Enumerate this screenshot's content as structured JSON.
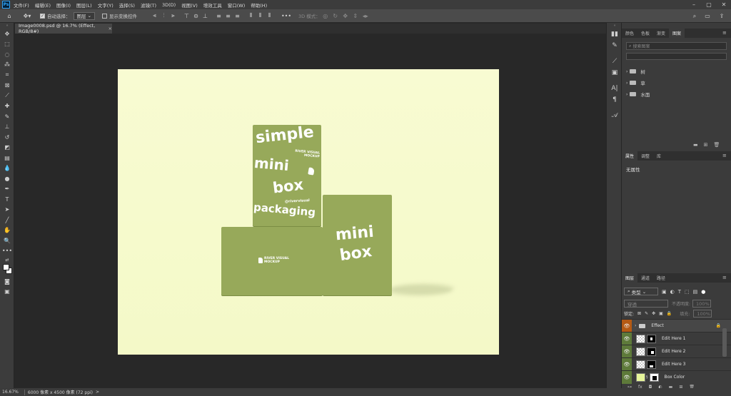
{
  "menu": {
    "app_logo": "Ps",
    "items": [
      "文件(F)",
      "编辑(E)",
      "图像(I)",
      "图层(L)",
      "文字(Y)",
      "选择(S)",
      "滤镜(T)",
      "3D(D)",
      "视图(V)",
      "增效工具",
      "窗口(W)",
      "帮助(H)"
    ]
  },
  "options": {
    "auto_select_label": "自动选择：",
    "auto_select_target": "图层",
    "show_transform_label": "显示变换控件",
    "mode_3d_label": "3D 模式："
  },
  "document_tab": {
    "title": "Image0008.psd @ 16.7% (Effect, RGB/8#)",
    "close": "×"
  },
  "artwork": {
    "tall_box_text": [
      "simple",
      "mini",
      "box",
      "packaging"
    ],
    "tall_box_brand": [
      "RIVER VISUAL",
      "MOCKUP"
    ],
    "tall_box_handle": "@rivervisual",
    "front_box_brand": [
      "RIVER VISUAL",
      "MOCKUP"
    ],
    "right_box_text": [
      "mini",
      "box"
    ]
  },
  "libraries_panel": {
    "tabs": [
      "颜色",
      "色板",
      "渐变",
      "图案"
    ],
    "active_tab": "图案",
    "search_placeholder": "搜索图案",
    "groups": [
      "树",
      "草",
      "水面"
    ]
  },
  "properties_panel": {
    "tabs": [
      "属性",
      "调整",
      "库"
    ],
    "active_tab": "属性",
    "empty_text": "无属性"
  },
  "layers_panel": {
    "tabs": [
      "图层",
      "通道",
      "路径"
    ],
    "active_tab": "图层",
    "filter_kind": "类型",
    "blend_mode": "穿透",
    "opacity_label": "不透明度:",
    "opacity_value": "100%",
    "lock_label": "锁定:",
    "fill_label": "填充:",
    "fill_value": "100%",
    "layers": [
      {
        "name": "Effect",
        "kind": "group",
        "locked": true
      },
      {
        "name": "Edit Here 1",
        "kind": "smart"
      },
      {
        "name": "Edit Here 2",
        "kind": "smart"
      },
      {
        "name": "Edit Here 3",
        "kind": "smart"
      },
      {
        "name": "Box Color",
        "kind": "fill"
      }
    ]
  },
  "status": {
    "zoom": "16.67%",
    "doc_info": "6000 像素 x 4500 像素 (72 ppi)",
    "arrow": ">"
  },
  "colors": {
    "box_green": "#97a95a",
    "background_yellow": "#f8fbd2",
    "eye_column": "#5e7a3a",
    "group_row": "#b55a14"
  }
}
